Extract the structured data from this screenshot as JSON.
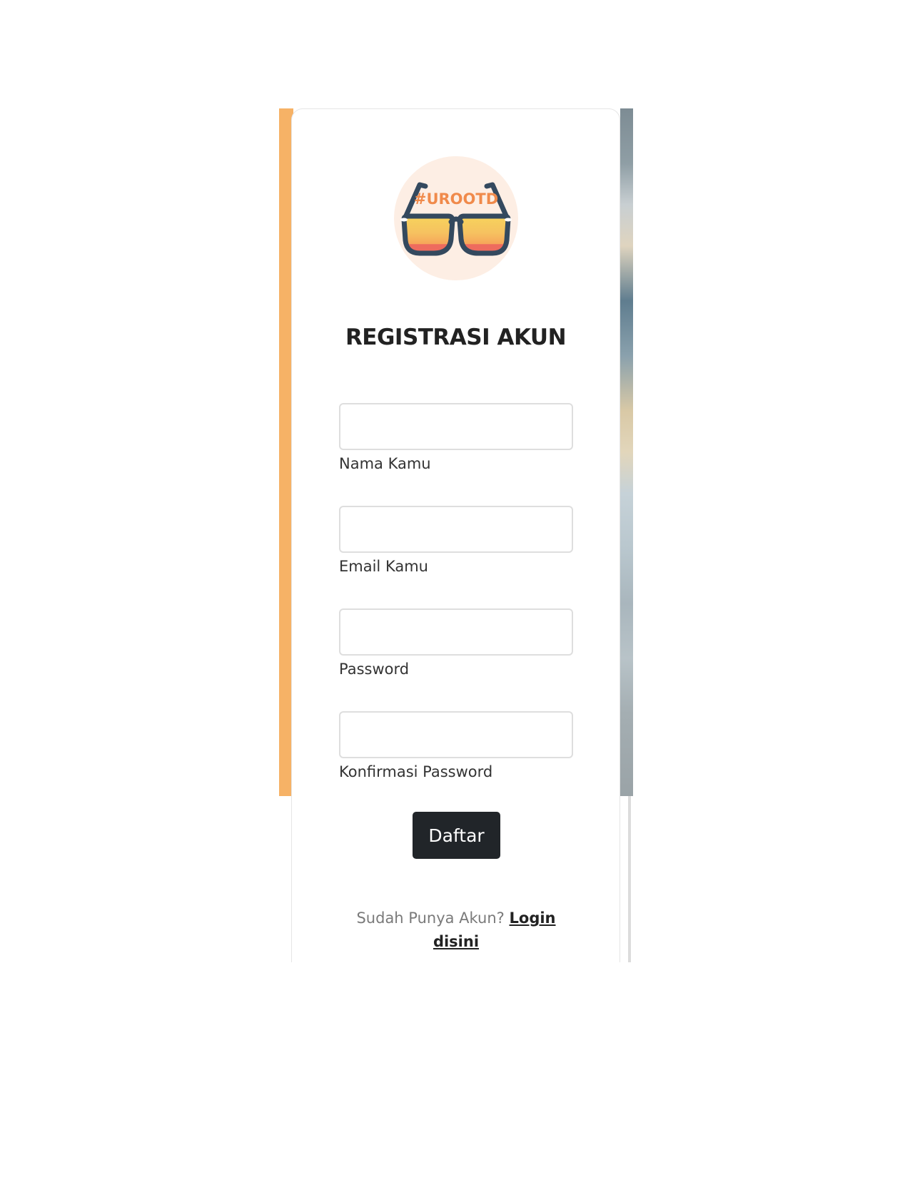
{
  "logo": {
    "text": "#UROOTD",
    "icon": "sunglasses-icon",
    "colors": {
      "circle": "#fdeee4",
      "frame": "#34495e",
      "text": "#f08a4b",
      "lens_top": "#f7d35c",
      "lens_mid": "#f6a65a",
      "lens_bottom": "#ee6b5e"
    }
  },
  "form": {
    "title": "REGISTRASI AKUN",
    "fields": [
      {
        "label": "Nama Kamu",
        "value": "",
        "type": "text"
      },
      {
        "label": "Email Kamu",
        "value": "",
        "type": "email"
      },
      {
        "label": "Password",
        "value": "",
        "type": "password"
      },
      {
        "label": "Konfirmasi Password",
        "value": "",
        "type": "password"
      }
    ],
    "submit_label": "Daftar"
  },
  "footer": {
    "prompt": "Sudah Punya Akun?",
    "link_label": "Login disini"
  },
  "colors": {
    "button_bg": "#212529",
    "accent_orange": "#f6b266"
  }
}
